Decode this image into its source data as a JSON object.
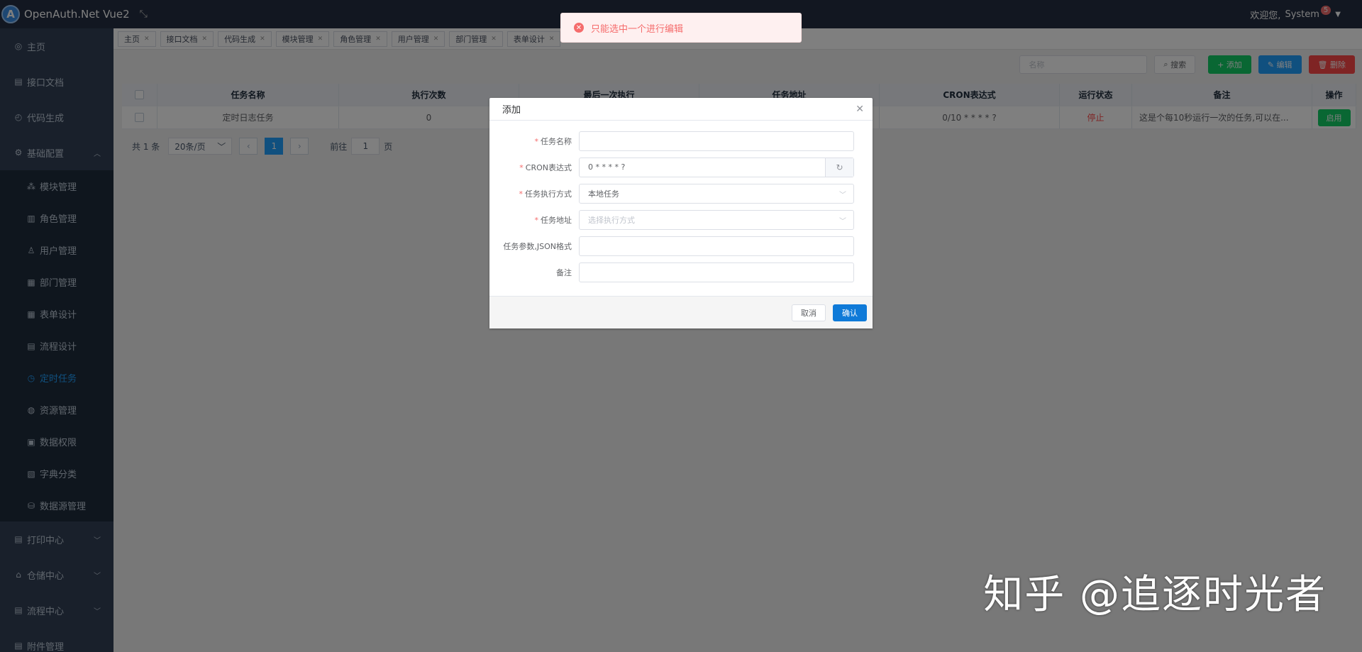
{
  "header": {
    "app_title": "OpenAuth.Net Vue2",
    "welcome": "欢迎您,",
    "user": "System",
    "badge": "5"
  },
  "sidebar": {
    "items_top": [
      {
        "label": "主页",
        "icon": "home-icon"
      },
      {
        "label": "接口文档",
        "icon": "doc-icon"
      },
      {
        "label": "代码生成",
        "icon": "code-icon"
      },
      {
        "label": "基础配置",
        "icon": "gear-icon"
      }
    ],
    "sub_items": [
      {
        "label": "模块管理",
        "icon": "module-icon"
      },
      {
        "label": "角色管理",
        "icon": "role-icon"
      },
      {
        "label": "用户管理",
        "icon": "user-icon"
      },
      {
        "label": "部门管理",
        "icon": "dept-icon"
      },
      {
        "label": "表单设计",
        "icon": "form-icon"
      },
      {
        "label": "流程设计",
        "icon": "flow-icon"
      },
      {
        "label": "定时任务",
        "icon": "timer-icon"
      },
      {
        "label": "资源管理",
        "icon": "resource-icon"
      },
      {
        "label": "数据权限",
        "icon": "data-icon"
      },
      {
        "label": "字典分类",
        "icon": "dict-icon"
      },
      {
        "label": "数据源管理",
        "icon": "db-icon"
      }
    ],
    "items_bottom": [
      {
        "label": "打印中心",
        "icon": "print-icon"
      },
      {
        "label": "仓储中心",
        "icon": "warehouse-icon"
      },
      {
        "label": "流程中心",
        "icon": "flow-center-icon"
      },
      {
        "label": "附件管理",
        "icon": "attachment-icon"
      }
    ]
  },
  "tags": [
    "主页",
    "接口文档",
    "代码生成",
    "模块管理",
    "角色管理",
    "用户管理",
    "部门管理",
    "表单设计"
  ],
  "toolbar": {
    "search_placeholder": "名称",
    "search_label": "搜索",
    "add_label": "添加",
    "edit_label": "编辑",
    "delete_label": "删除"
  },
  "table": {
    "headers": [
      "任务名称",
      "执行次数",
      "最后一次执行",
      "任务地址",
      "CRON表达式",
      "运行状态",
      "备注",
      "操作"
    ],
    "rows": [
      {
        "name": "定时日志任务",
        "count": "0",
        "last": "",
        "address": "",
        "cron": "0/10 * * * * ?",
        "status": "停止",
        "remark": "这是个每10秒运行一次的任务,可以在...",
        "action": "启用"
      }
    ]
  },
  "pager": {
    "total": "共 1 条",
    "size": "20条/页",
    "current": "1",
    "goto_label": "前往",
    "goto_value": "1",
    "page_label": "页"
  },
  "toast": {
    "message": "只能选中一个进行编辑"
  },
  "dialog": {
    "title": "添加",
    "fields": {
      "name_label": "任务名称",
      "cron_label": "CRON表达式",
      "cron_value": "0 * * * * ?",
      "exec_label": "任务执行方式",
      "exec_value": "本地任务",
      "addr_label": "任务地址",
      "addr_placeholder": "选择执行方式",
      "param_label": "任务参数,JSON格式",
      "remark_label": "备注"
    },
    "cancel_label": "取消",
    "confirm_label": "确认"
  },
  "watermark": "知乎 @追逐时光者"
}
